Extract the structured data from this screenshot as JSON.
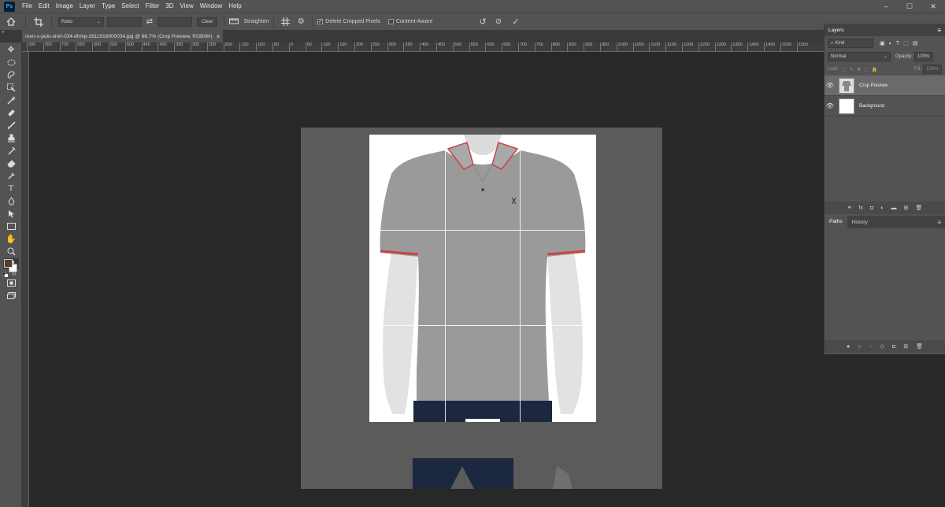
{
  "menubar": {
    "logo": "Ps",
    "items": [
      "File",
      "Edit",
      "Image",
      "Layer",
      "Type",
      "Select",
      "Filter",
      "3D",
      "View",
      "Window",
      "Help"
    ],
    "window_controls": [
      "–",
      "☐",
      "✕"
    ]
  },
  "options": {
    "ratio_label": "Ratio",
    "swap_icon": "⇄",
    "clear_label": "Clear",
    "straighten_label": "Straighten",
    "delete_cropped_label": "Delete Cropped Pixels",
    "delete_cropped_checked": true,
    "content_aware_label": "Content-Aware",
    "content_aware_checked": false,
    "undo_icon": "↺",
    "cancel_icon": "⊘",
    "commit_icon": "✓"
  },
  "document": {
    "tab_title": "men-s-polo-shirt-034-dhmp-2611916000034.jpg @ 66.7% (Crop Preview, RGB/8#)",
    "close_icon": "×"
  },
  "ruler": {
    "ticks": [
      "300",
      "350",
      "700",
      "650",
      "600",
      "550",
      "500",
      "450",
      "400",
      "350",
      "300",
      "250",
      "200",
      "150",
      "100",
      "50",
      "0",
      "50",
      "100",
      "150",
      "200",
      "250",
      "300",
      "350",
      "400",
      "450",
      "500",
      "550",
      "600",
      "650",
      "700",
      "750",
      "800",
      "850",
      "900",
      "950",
      "1000",
      "1050",
      "1100",
      "1150",
      "1200",
      "1250",
      "1300",
      "1350",
      "1400",
      "1450",
      "1500",
      "1550"
    ]
  },
  "layers_panel": {
    "title": "Layers",
    "kind_placeholder": "Kind",
    "blend_mode": "Normal",
    "opacity_label": "Opacity:",
    "opacity_value": "100%",
    "lock_label": "Lock:",
    "fill_label": "Fill:",
    "fill_value": "100%",
    "layers": [
      {
        "name": "Crop Preview",
        "selected": true
      },
      {
        "name": "Background",
        "selected": false
      }
    ]
  },
  "paths_panel": {
    "tabs": [
      "Paths",
      "History"
    ]
  },
  "colors": {
    "ui_bg": "#535353",
    "canvas_bg": "#282828",
    "artboard": "#5b5b5b",
    "foreground_swatch": "#5a3a2a",
    "background_swatch": "#ffffff",
    "shirt": "#9a9a9a",
    "jeans": "#1c2740"
  }
}
